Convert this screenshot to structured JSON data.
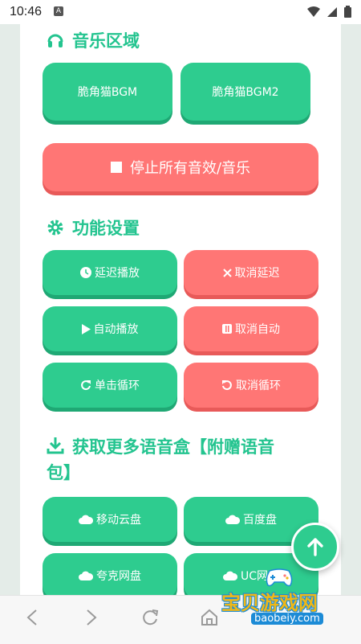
{
  "status_bar": {
    "time": "10:46",
    "app_badge": "A"
  },
  "music": {
    "title": "音乐区域",
    "bgm1": "脆角猫BGM",
    "bgm2": "脆角猫BGM2",
    "stop_all": "停止所有音效/音乐"
  },
  "features": {
    "title": "功能设置",
    "delay_play": "延迟播放",
    "cancel_delay": "取消延迟",
    "auto_play": "自动播放",
    "cancel_auto": "取消自动",
    "single_loop": "单击循环",
    "cancel_loop": "取消循环"
  },
  "download": {
    "title_line1": "获取更多语音盒【附赠语音",
    "title_line2": "包】",
    "mobile_cloud": "移动云盘",
    "baidu": "百度盘",
    "quark": "夸克网盘",
    "uc": "UC网盘"
  },
  "watermark": {
    "text": "宝贝游戏网",
    "url": "baobeiy.com"
  },
  "colors": {
    "green": "#2ecc8f",
    "red": "#ff7675"
  }
}
